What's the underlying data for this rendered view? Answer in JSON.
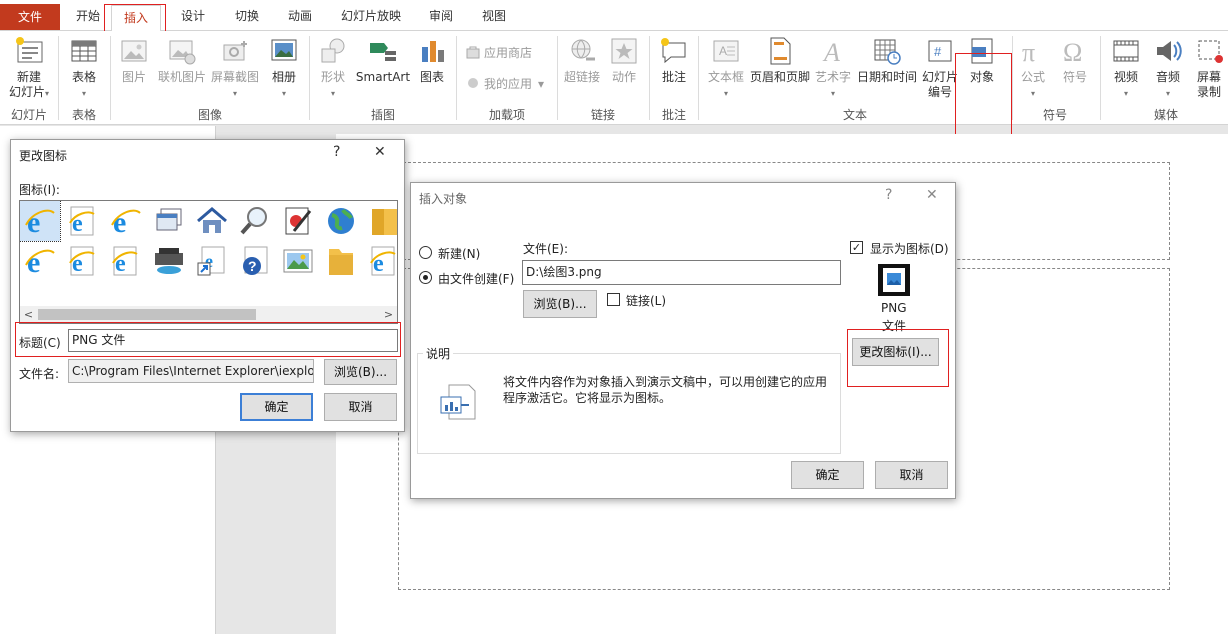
{
  "tabs": {
    "file": "文件",
    "home": "开始",
    "insert": "插入",
    "design": "设计",
    "transitions": "切换",
    "animations": "动画",
    "slideshow": "幻灯片放映",
    "review": "审阅",
    "view": "视图"
  },
  "ribbon": {
    "new_slide_1": "新建",
    "new_slide_2": "幻灯片",
    "table": "表格",
    "picture": "图片",
    "online_picture": "联机图片",
    "screenshot": "屏幕截图",
    "album": "相册",
    "shapes": "形状",
    "smartart": "SmartArt",
    "chart": "图表",
    "store": "应用商店",
    "my_apps": "我的应用",
    "hyperlink": "超链接",
    "action": "动作",
    "comment": "批注",
    "textbox": "文本框",
    "header_footer": "页眉和页脚",
    "wordart": "艺术字",
    "datetime": "日期和时间",
    "slide_number_1": "幻灯片",
    "slide_number_2": "编号",
    "object": "对象",
    "equation": "公式",
    "symbol": "符号",
    "video": "视频",
    "audio": "音频",
    "screen_record_1": "屏幕",
    "screen_record_2": "录制",
    "groups": {
      "slides": "幻灯片",
      "tables": "表格",
      "images": "图像",
      "illustrations": "插图",
      "addins": "加载项",
      "links": "链接",
      "comments": "批注",
      "text": "文本",
      "symbols": "符号",
      "media": "媒体"
    }
  },
  "change_icon_dialog": {
    "title": "更改图标",
    "help": "?",
    "close": "✕",
    "icon_label": "图标(I):",
    "caption_label": "标题(C)",
    "caption_value": "PNG 文件",
    "filename_label": "文件名:",
    "filename_value": "C:\\Program Files\\Internet Explorer\\iexplore.exe",
    "browse": "浏览(B)...",
    "ok": "确定",
    "cancel": "取消",
    "icons": [
      "ie-blue-icon",
      "ie-white-icon",
      "ie-blue-icon",
      "window-stack-icon",
      "house-icon",
      "magnifier-icon",
      "document-pen-icon",
      "globe-icon",
      "folder-icon",
      "ie-blue-icon",
      "ie-white-icon",
      "ie-white-icon",
      "drive-icon",
      "shortcut-icon",
      "help-icon",
      "picture-icon",
      "folder-icon",
      "ie-white-icon"
    ]
  },
  "insert_object_dialog": {
    "title": "插入对象",
    "help": "?",
    "close": "✕",
    "create_new": "新建(N)",
    "create_from_file": "由文件创建(F)",
    "file_label": "文件(E):",
    "file_value": "D:\\绘图3.png",
    "browse": "浏览(B)...",
    "link": "链接(L)",
    "display_as_icon": "显示为图标(D)",
    "icon_caption_1": "PNG",
    "icon_caption_2": "文件",
    "change_icon": "更改图标(I)...",
    "result_label": "说明",
    "result_text_1": "将文件内容作为对象插入到演示文稿中，可以用创建它的应用",
    "result_text_2": "程序激活它。它将显示为图标。",
    "ok": "确定",
    "cancel": "取消"
  },
  "colors": {
    "accent": "#c23a1e",
    "highlight": "#e02020",
    "focus": "#3c7fd6"
  }
}
